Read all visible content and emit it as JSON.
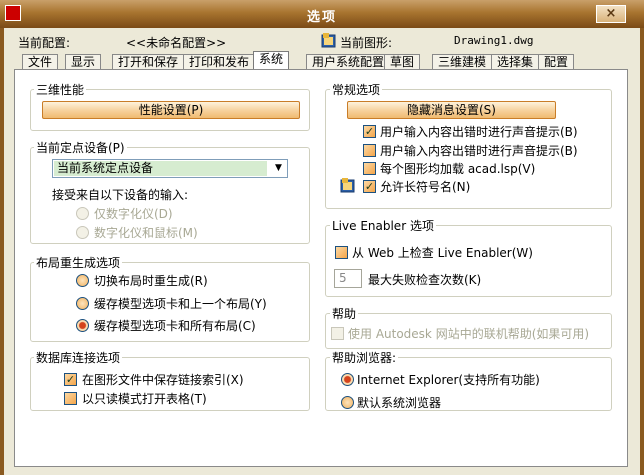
{
  "window": {
    "title": "选项",
    "close_glyph": "×"
  },
  "header": {
    "config_label": "当前配置:",
    "config_value": "<<未命名配置>>",
    "drawing_label": "当前图形:",
    "drawing_value": "Drawing1.dwg"
  },
  "tabs": [
    "文件",
    "显示",
    "打开和保存",
    "打印和发布",
    "系统",
    "用户系统配置",
    "草图",
    "三维建模",
    "选择集",
    "配置"
  ],
  "active_tab": "系统",
  "left": {
    "perf": {
      "title": "三维性能",
      "button": "性能设置(P)"
    },
    "device": {
      "title": "当前定点设备(P)",
      "select_value": "当前系统定点设备",
      "accept_label": "接受来自以下设备的输入:",
      "opt1": "仅数字化仪(D)",
      "opt2": "数字化仪和鼠标(M)"
    },
    "layout": {
      "title": "布局重生成选项",
      "opt1": "切换布局时重生成(R)",
      "opt2": "缓存模型选项卡和上一个布局(Y)",
      "opt3": "缓存模型选项卡和所有布局(C)"
    },
    "db": {
      "title": "数据库连接选项",
      "opt1": "在图形文件中保存链接索引(X)",
      "opt2": "以只读模式打开表格(T)"
    }
  },
  "right": {
    "general": {
      "title": "常规选项",
      "button": "隐藏消息设置(S)",
      "opt1": "用户输入内容出错时进行声音提示(B)",
      "opt2": "用户输入内容出错时进行声音提示(B)",
      "opt3": "每个图形均加载 acad.lsp(V)",
      "opt4": "允许长符号名(N)"
    },
    "live": {
      "title": "Live Enabler 选项",
      "opt1": "从 Web 上检查 Live Enabler(W)",
      "max_value": "5",
      "max_label": "最大失败检查次数(K)"
    },
    "help": {
      "title": "帮助",
      "opt1": "使用 Autodesk 网站中的联机帮助(如果可用)"
    },
    "browser": {
      "title": "帮助浏览器:",
      "opt1": "Internet Explorer(支持所有功能)",
      "opt2": "默认系统浏览器"
    }
  },
  "colors": {
    "title_bar": "#a8742f",
    "button_orange": "#f7d3a0",
    "dialog_bg": "#ece9d8"
  }
}
